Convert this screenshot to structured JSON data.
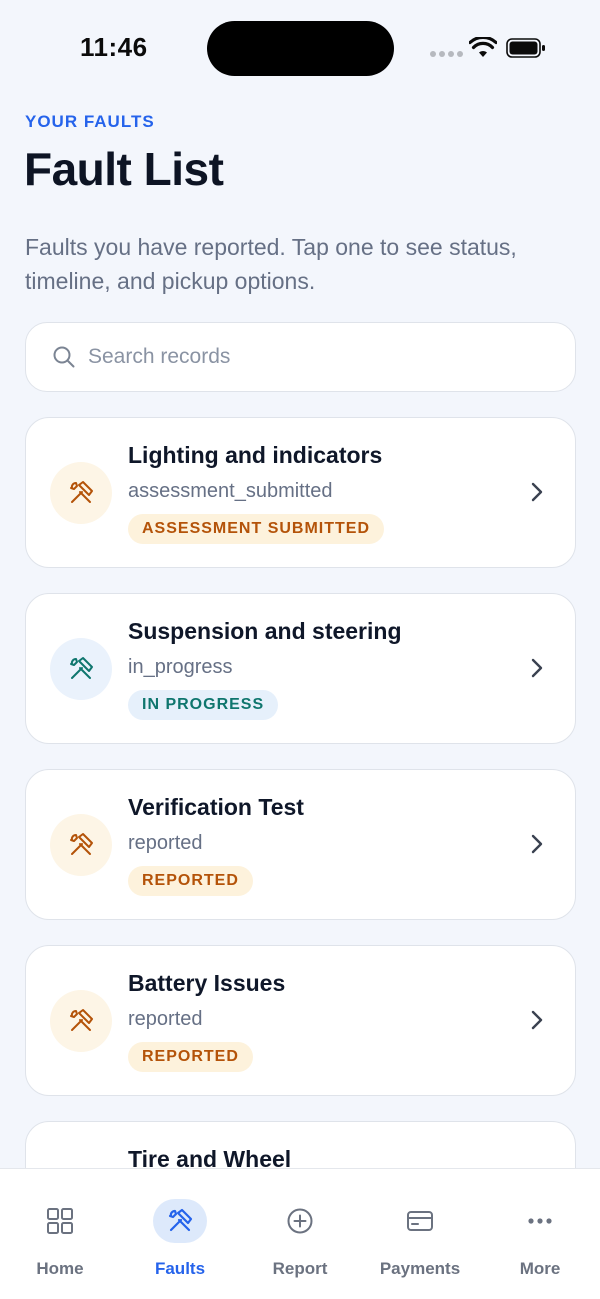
{
  "status_bar": {
    "time": "11:46"
  },
  "header": {
    "eyebrow": "YOUR FAULTS",
    "title": "Fault List",
    "subtitle": "Faults you have reported. Tap one to see status, timeline, and pickup options."
  },
  "search": {
    "placeholder": "Search records",
    "value": ""
  },
  "faults": [
    {
      "title": "Lighting and indicators",
      "code": "assessment_submitted",
      "badge": "ASSESSMENT SUBMITTED",
      "tone": "warn"
    },
    {
      "title": "Suspension and steering",
      "code": "in_progress",
      "badge": "IN PROGRESS",
      "tone": "info"
    },
    {
      "title": "Verification Test",
      "code": "reported",
      "badge": "REPORTED",
      "tone": "warn"
    },
    {
      "title": "Battery Issues",
      "code": "reported",
      "badge": "REPORTED",
      "tone": "warn"
    },
    {
      "title": "Tire and Wheel"
    }
  ],
  "tab_bar": {
    "active": "Faults",
    "tabs": [
      {
        "label": "Home",
        "icon": "grid-icon"
      },
      {
        "label": "Faults",
        "icon": "tools-icon"
      },
      {
        "label": "Report",
        "icon": "plus-circle-icon"
      },
      {
        "label": "Payments",
        "icon": "card-icon"
      },
      {
        "label": "More",
        "icon": "more-icon"
      }
    ]
  },
  "colors": {
    "accent": "#2563eb",
    "warn_text": "#b45309",
    "warn_bg": "#fdf2dc",
    "info_text": "#0f766e",
    "info_bg": "#e6f0fb",
    "background": "#f3f6fc"
  }
}
